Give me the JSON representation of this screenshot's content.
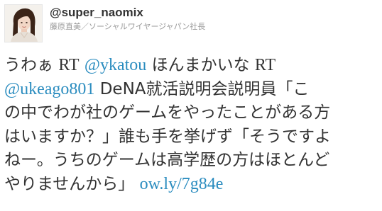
{
  "user": {
    "handle": "@super_naomix",
    "subtitle": "藤原直美／ソーシャルワイヤージャパン社長"
  },
  "tweet": {
    "line1_a": "うわぁ ",
    "line1_rt1": "RT",
    "line1_mention": "@ykatou",
    "line1_b": " ほんまかいな ",
    "line1_rt2": "RT",
    "line2_mention": "@ukeago801",
    "line2_b": " DeNA就活説明会説明員「こ",
    "line3": "の中でわが社のゲームをやったことがある方",
    "line4": "はいますか？」誰も手を挙げず「そうですよ",
    "line5": "ねー。うちのゲームは高学歴の方はほとんど",
    "line6": "やりませんから」",
    "link": "ow.ly/7g84e"
  },
  "colors": {
    "text": "#333333",
    "link": "#2a8cbf",
    "subtitle": "#999999"
  }
}
